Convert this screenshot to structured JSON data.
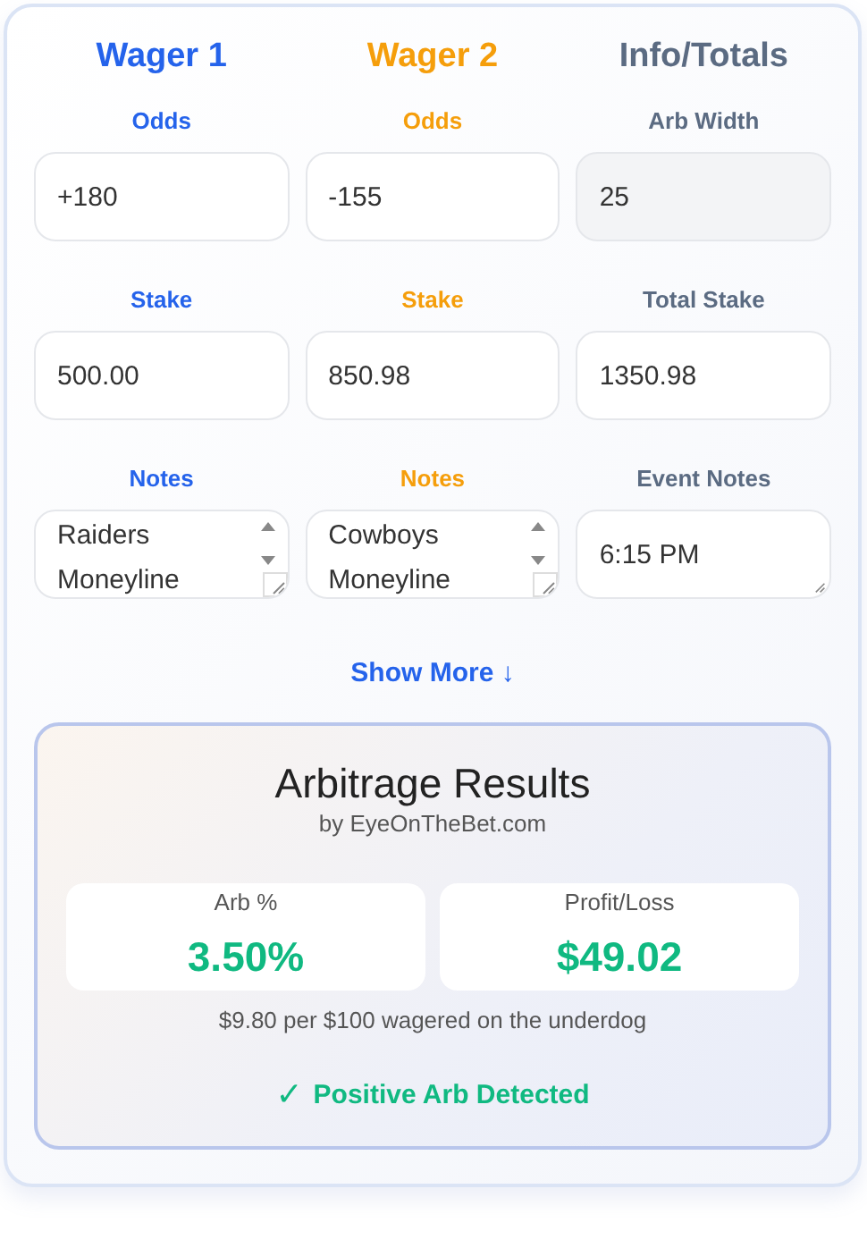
{
  "columns": [
    {
      "title": "Wager 1",
      "color": "#2563eb",
      "fields": [
        {
          "label": "Odds",
          "kind": "input",
          "value": "+180"
        },
        {
          "label": "Stake",
          "kind": "input",
          "value": "500.00"
        },
        {
          "label": "Notes",
          "kind": "textarea",
          "scrollable": true,
          "value": "Raiders Moneyline"
        }
      ]
    },
    {
      "title": "Wager 2",
      "color": "#f59e0b",
      "fields": [
        {
          "label": "Odds",
          "kind": "input",
          "value": "-155"
        },
        {
          "label": "Stake",
          "kind": "input",
          "value": "850.98"
        },
        {
          "label": "Notes",
          "kind": "textarea",
          "scrollable": true,
          "value": "Cowboys Moneyline"
        }
      ]
    },
    {
      "title": "Info/Totals",
      "color": "#5b6b82",
      "fields": [
        {
          "label": "Arb Width",
          "kind": "readonly",
          "value": "25"
        },
        {
          "label": "Total Stake",
          "kind": "input",
          "value": "1350.98"
        },
        {
          "label": "Event Notes",
          "kind": "textarea",
          "scrollable": false,
          "value": "6:15 PM"
        }
      ]
    }
  ],
  "show_more": "Show More ↓",
  "results": {
    "title": "Arbitrage Results",
    "subtitle": "by EyeOnTheBet.com",
    "positive": true,
    "stats": [
      {
        "label": "Arb %",
        "value": "3.50%"
      },
      {
        "label": "Profit/Loss",
        "value": "$49.02"
      }
    ],
    "note": "$9.80 per $100 wagered on the underdog",
    "status": {
      "icon": "✓",
      "text": "Positive Arb Detected"
    }
  }
}
